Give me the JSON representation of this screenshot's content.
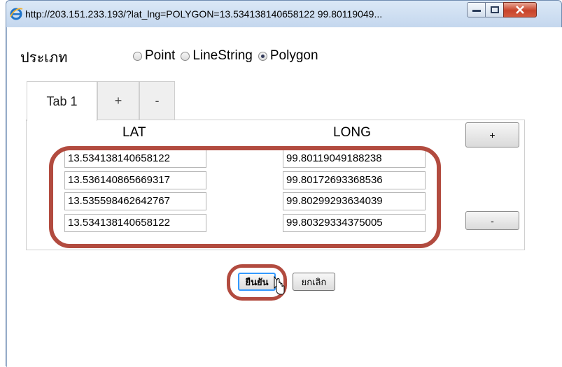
{
  "window": {
    "title": "http://203.151.233.193/?lat_lng=POLYGON=13.534138140658122 99.80119049..."
  },
  "form": {
    "type_label": "ประเภท",
    "geometry_options": [
      {
        "label": "Point",
        "selected": false
      },
      {
        "label": "LineString",
        "selected": false
      },
      {
        "label": "Polygon",
        "selected": true
      }
    ]
  },
  "tabs": [
    {
      "label": "Tab 1",
      "active": true
    },
    {
      "label": "+",
      "active": false
    },
    {
      "label": "-",
      "active": false
    }
  ],
  "table": {
    "lat_header": "LAT",
    "long_header": "LONG",
    "rows": [
      {
        "lat": "13.534138140658122",
        "long": "99.80119049188238"
      },
      {
        "lat": "13.536140865669317",
        "long": "99.80172693368536"
      },
      {
        "lat": "13.535598462642767",
        "long": "99.80299293634039"
      },
      {
        "lat": "13.534138140658122",
        "long": "99.80329334375005"
      }
    ],
    "add_row_label": "+",
    "remove_row_label": "-"
  },
  "actions": {
    "confirm_label": "ยืนยัน",
    "cancel_label": "ยกเลิก"
  },
  "colors": {
    "highlight": "#b24b3f",
    "close_button": "#c7432a",
    "focus_border": "#3399ff"
  }
}
